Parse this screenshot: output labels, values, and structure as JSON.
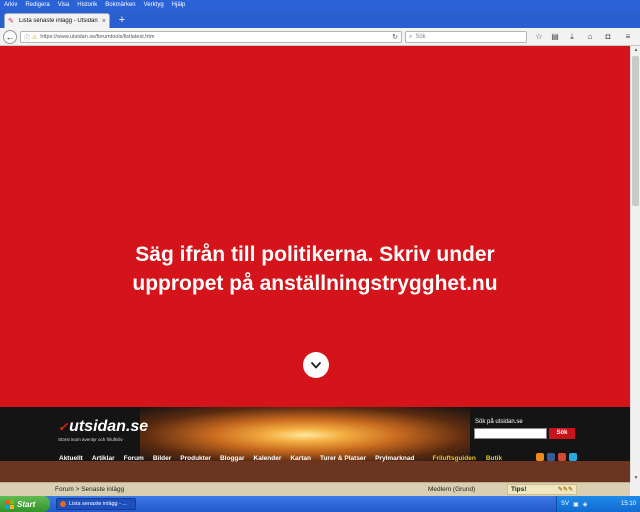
{
  "browser": {
    "menu": [
      "Arkiv",
      "Redigera",
      "Visa",
      "Historik",
      "Bokmärken",
      "Verktyg",
      "Hjälp"
    ],
    "tab_title": "Lista senaste inlägg - Utsidan",
    "new_tab": "+",
    "url": "https://www.utsidan.se/forumtools/listlatest.htm",
    "search_placeholder": "Sök"
  },
  "banner": {
    "line1": "Säg ifrån till politikerna. Skriv under",
    "line2": "uppropet på anställningstrygghet.nu",
    "color": "#d5131b"
  },
  "site": {
    "logo": "utsidan.se",
    "tagline": "Störst inom äventyr och friluftsliv",
    "search_label": "Sök på utsidan.se",
    "search_button": "Sök",
    "nav": [
      "Aktuellt",
      "Artiklar",
      "Forum",
      "Bilder",
      "Produkter",
      "Bloggar",
      "Kalender",
      "Kartan",
      "Turer & Platser",
      "Prylmarknad"
    ],
    "nav_highlight": [
      "Friluftsguiden",
      "Butik"
    ]
  },
  "bottom": {
    "breadcrumb": "Forum > Senaste inlägg",
    "member": "Medlem (Grund)",
    "tips": "Tips!"
  },
  "taskbar": {
    "start": "Start",
    "task": "Lista senaste inlägg - ...",
    "clock": "15:10",
    "tray_lang": "SV"
  }
}
